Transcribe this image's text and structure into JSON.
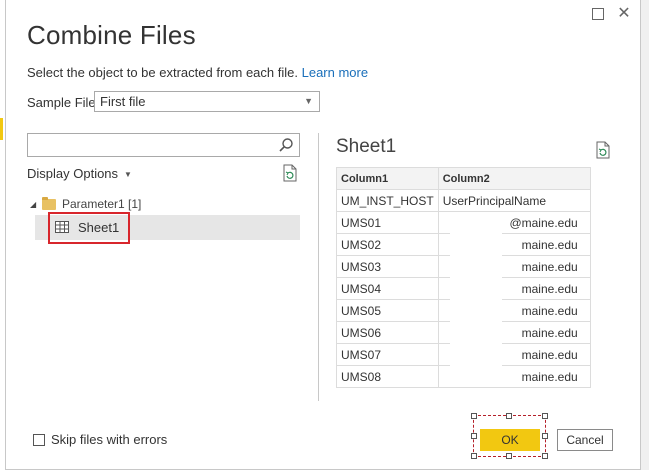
{
  "dialog": {
    "title": "Combine Files",
    "subtitle": "Select the object to be extracted from each file.",
    "learn_more": "Learn more",
    "sample_file_label": "Sample File:",
    "sample_file_value": "First file"
  },
  "navigator": {
    "search_placeholder": "",
    "display_options_label": "Display Options",
    "folder_label": "Parameter1 [1]",
    "sheet_label": "Sheet1"
  },
  "preview": {
    "title": "Sheet1",
    "columns": [
      "Column1",
      "Column2"
    ],
    "rows": [
      [
        "UM_INST_HOST",
        "UserPrincipalName"
      ],
      [
        "UMS01",
        "@maine.edu"
      ],
      [
        "UMS02",
        "maine.edu"
      ],
      [
        "UMS03",
        "maine.edu"
      ],
      [
        "UMS04",
        "maine.edu"
      ],
      [
        "UMS05",
        "maine.edu"
      ],
      [
        "UMS06",
        "maine.edu"
      ],
      [
        "UMS07",
        "maine.edu"
      ],
      [
        "UMS08",
        "maine.edu"
      ]
    ]
  },
  "footer": {
    "skip_files_label": "Skip files with errors",
    "ok_label": "OK",
    "cancel_label": "Cancel"
  },
  "colors": {
    "accent": "#f2c811",
    "link": "#1a6fba",
    "highlight_border": "#d8262c"
  }
}
